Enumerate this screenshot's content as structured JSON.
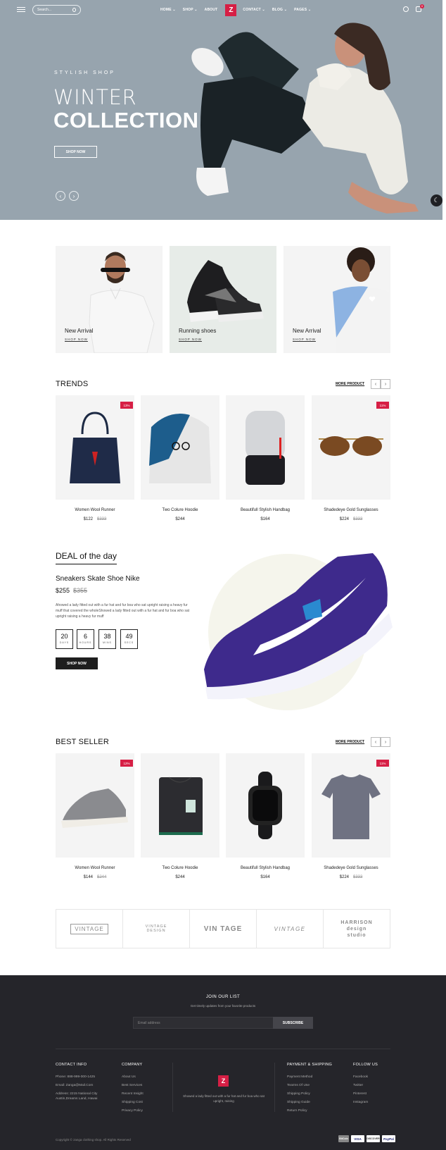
{
  "header": {
    "search_placeholder": "Search...",
    "nav": [
      "HOME ⌄",
      "SHOP ⌄",
      "ABOUT",
      "CONTACT ⌄",
      "BLOG ⌄",
      "PAGES ⌄"
    ],
    "logo": "Z",
    "cart_count": "0"
  },
  "hero": {
    "subtitle": "STYLISH SHOP",
    "title_line1": "WINTER",
    "title_line2": "COLLECTION",
    "button": "SHOP NOW",
    "bg_color": "#97a4ae"
  },
  "categories": [
    {
      "name": "New Arrival",
      "link": "SHOP NOW"
    },
    {
      "name": "Running shoes",
      "link": "SHOP NOW"
    },
    {
      "name": "New Arrival",
      "link": "SHOP NOW"
    }
  ],
  "trends": {
    "title": "TRENDS",
    "more": "MORE PRODUCT",
    "products": [
      {
        "name": "Women Wool Runner",
        "price": "$122",
        "old_price": "$333",
        "badge": "13%"
      },
      {
        "name": "Two Colure Hoodie",
        "price": "$244",
        "old_price": "",
        "badge": ""
      },
      {
        "name": "Beautifull Stylish Handbag",
        "price": "$164",
        "old_price": "",
        "badge": ""
      },
      {
        "name": "Shadedeye Gold Sunglasses",
        "price": "$224",
        "old_price": "$333",
        "badge": "11%"
      }
    ]
  },
  "deal": {
    "title_word": "DEAL",
    "title_rest": " of the day",
    "product": "Sneakers Skate Shoe Nike",
    "price": "$255",
    "old_price": "$355",
    "description": "Ahowed a lady fitted out with a fur hat and fur boa who sat upright raising a heavy fur muff that covered the wholeShowed a lady fitted out with a fur hat and fur boa who sat upright raising a heavy fur muff",
    "countdown": [
      {
        "value": "20",
        "label": "DAYS"
      },
      {
        "value": "6",
        "label": "HOURS"
      },
      {
        "value": "38",
        "label": "MINS"
      },
      {
        "value": "49",
        "label": "SECS"
      }
    ],
    "button": "SHOP NOW"
  },
  "bestseller": {
    "title": "BEST SELLER",
    "more": "MORE PRODUCT",
    "products": [
      {
        "name": "Women Wool Runner",
        "price": "$144",
        "old_price": "$244",
        "badge": "12%"
      },
      {
        "name": "Two Colure Hoodie",
        "price": "$244",
        "old_price": "",
        "badge": ""
      },
      {
        "name": "Beautifull Stylish Handbag",
        "price": "$164",
        "old_price": "",
        "badge": ""
      },
      {
        "name": "Shadedeye Gold Sunglasses",
        "price": "$224",
        "old_price": "$333",
        "badge": "11%"
      }
    ]
  },
  "brands": [
    "VINTAGE",
    "VINTAGE DESIGN",
    "VIN TAGE",
    "VINTAGE",
    "HARRISON design studio"
  ],
  "footer": {
    "join_title": "JOIN OUR LIST",
    "join_sub": "Get timely updates from your favorite products",
    "email_placeholder": "Email address",
    "subscribe": "SUBSCRIBE",
    "contact": {
      "title": "CONTACT INFO",
      "lines": [
        "Phone: 888-999-000-1425",
        "Email: Zanga@Mail.Com",
        "Address: 2215 National City",
        "Austin,Dreams Land, Hawai"
      ]
    },
    "company": {
      "title": "COMPANY",
      "lines": [
        "About Us",
        "Best Services",
        "Recent Insight",
        "Shipping Cost",
        "Privacy Policy"
      ]
    },
    "logo": "Z",
    "description": "Showed a lady fitted out with a fur hat and fur boa who sat upright, raising",
    "payment": {
      "title": "PAYMENT & SHIPPING",
      "lines": [
        "Payment Method",
        "Tearms Of Use",
        "Shipping Policy",
        "Shipping Guide",
        "Return Policy"
      ]
    },
    "follow": {
      "title": "FOLLOW US",
      "lines": [
        "Facebook",
        "Twitter",
        "Pinterest",
        "Instagram"
      ]
    },
    "copyright": "Copyright © zanga clothing shop. All Rights Reserved",
    "payments": [
      "BitCoin",
      "VISA",
      "DISCOVER",
      "PayPal"
    ]
  }
}
